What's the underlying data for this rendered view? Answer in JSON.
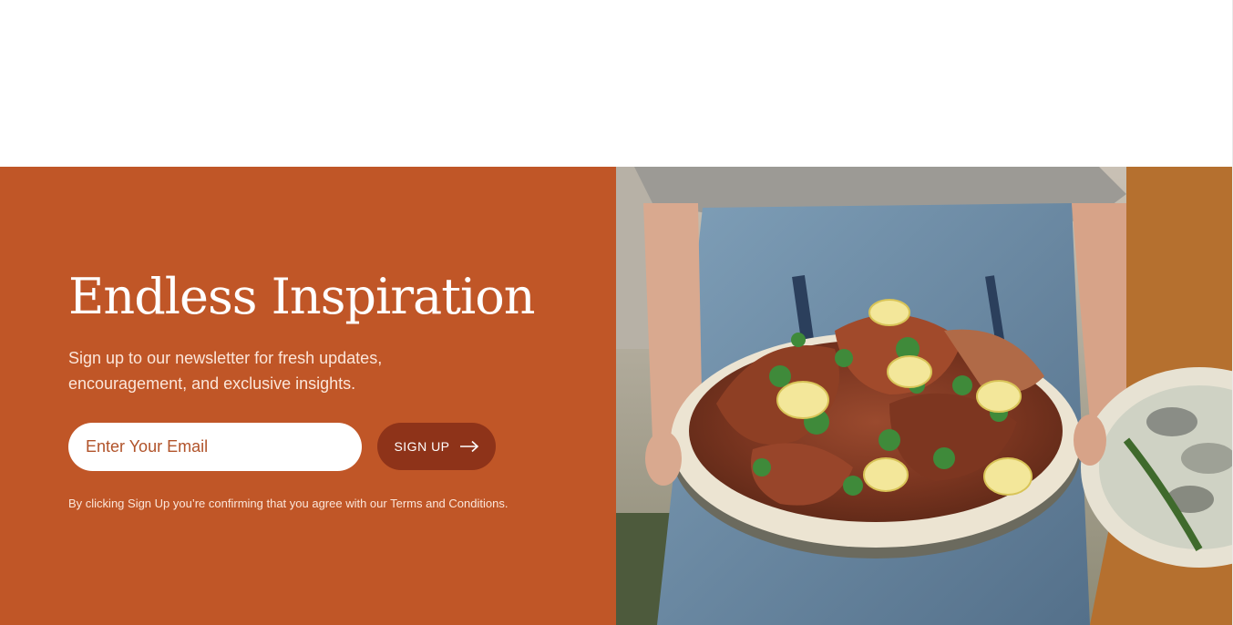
{
  "newsletter": {
    "heading": "Endless Inspiration",
    "subtext": "Sign up to our newsletter for fresh updates, encouragement, and exclusive insights.",
    "email_placeholder": "Enter Your Email",
    "email_value": "",
    "signup_label": "SIGN UP",
    "signup_icon": "arrow-right-icon",
    "terms": "By clicking Sign Up you’re confirming that you agree with our Terms and Conditions."
  },
  "photo": {
    "subject": "person holding a platter of grilled octopus with lemon slices and herbs"
  },
  "colors": {
    "panel": "#c05627",
    "button": "#8e3319",
    "input_text": "#b1532a",
    "white": "#ffffff"
  }
}
